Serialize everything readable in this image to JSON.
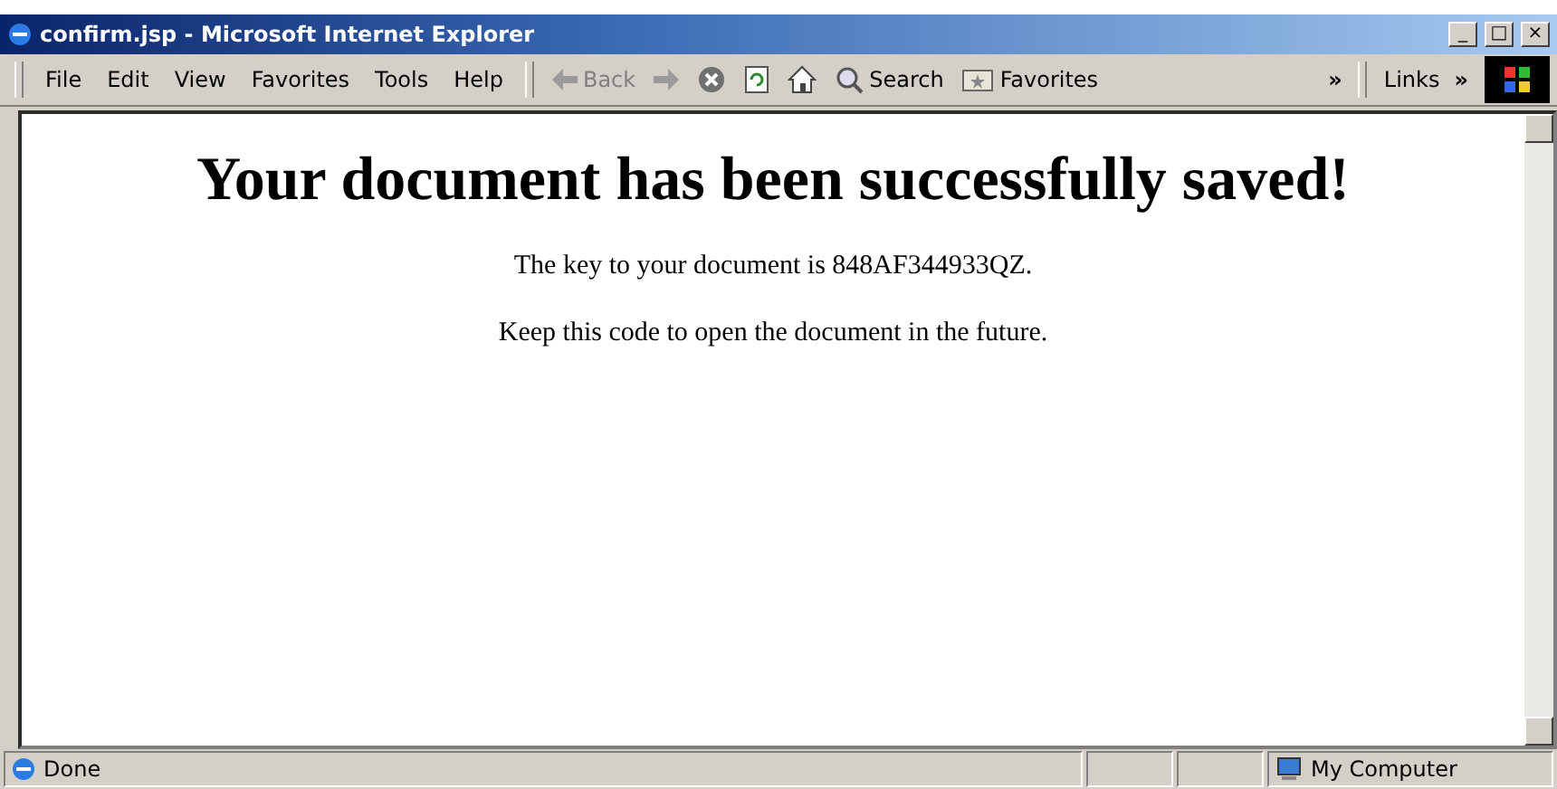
{
  "window": {
    "title": "confirm.jsp - Microsoft Internet Explorer",
    "controls": [
      "_",
      "□",
      "×"
    ]
  },
  "menu": [
    "File",
    "Edit",
    "View",
    "Favorites",
    "Tools",
    "Help"
  ],
  "toolbar": [
    {
      "kind": "back",
      "label": "Back"
    },
    {
      "kind": "forward"
    },
    {
      "kind": "stop"
    },
    {
      "kind": "refresh"
    },
    {
      "kind": "home"
    },
    {
      "kind": "search",
      "label": "Search"
    },
    {
      "kind": "favorites",
      "label": "Favorites"
    }
  ],
  "chevrons": [
    "»",
    "»"
  ],
  "links_label": "Links",
  "page": {
    "heading": "Your document has been successfully saved!",
    "paragraphs": [
      "The key to your document is 848AF344933QZ.",
      "Keep this code to open the document in the future."
    ]
  },
  "status_bar": {
    "text": "Done",
    "zone": "My Computer"
  }
}
